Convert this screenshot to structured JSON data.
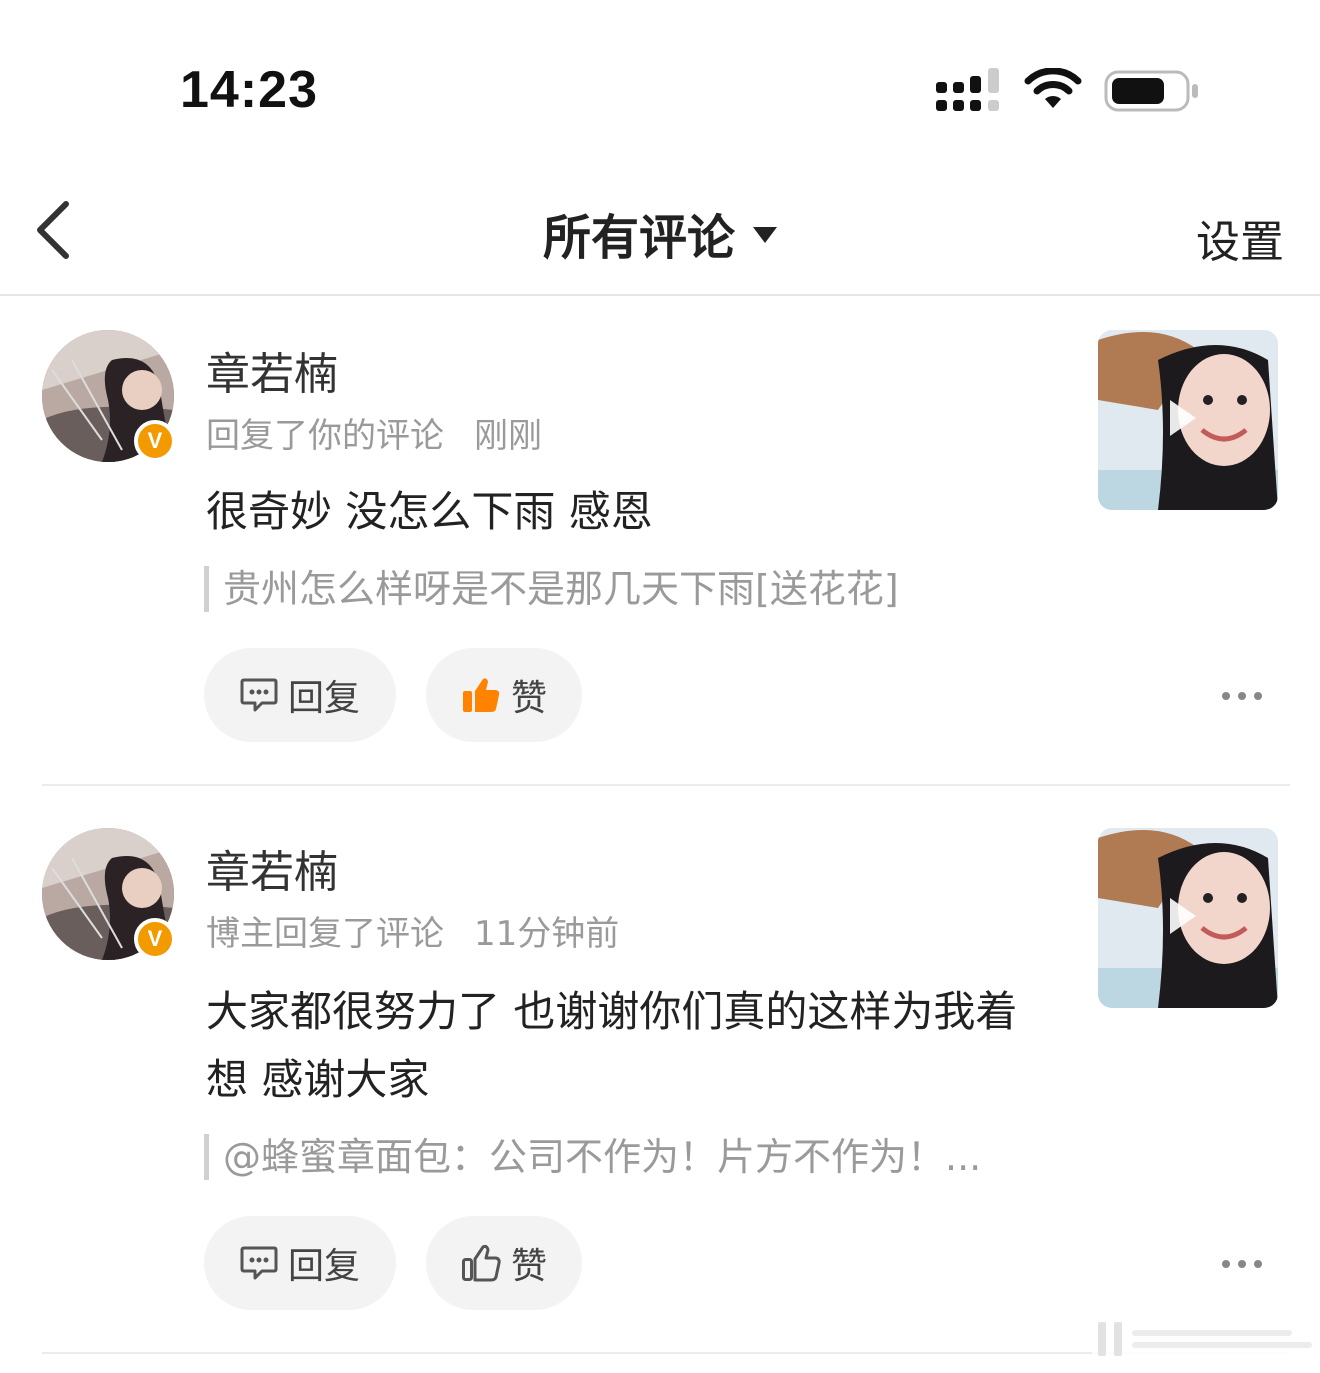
{
  "status_bar": {
    "time": "14:23"
  },
  "nav": {
    "title": "所有评论",
    "settings": "设置"
  },
  "comments": [
    {
      "username": "章若楠",
      "action": "回复了你的评论",
      "time": "刚刚",
      "text": "很奇妙 没怎么下雨 感恩",
      "quote": "贵州怎么样呀是不是那几天下雨[送花花]",
      "reply_label": "回复",
      "like_label": "赞",
      "liked": true
    },
    {
      "username": "章若楠",
      "action": "博主回复了评论",
      "time": "11分钟前",
      "text": "大家都很努力了 也谢谢你们真的这样为我着想 感谢大家",
      "quote": "@蜂蜜章面包：公司不作为！片方不作为！...",
      "reply_label": "回复",
      "like_label": "赞",
      "liked": false
    }
  ],
  "colors": {
    "liked_orange": "#ff8200",
    "verified_badge": "#f29a00",
    "meta_gray": "#9a9a9a"
  },
  "badge": {
    "verified_letter": "V"
  }
}
